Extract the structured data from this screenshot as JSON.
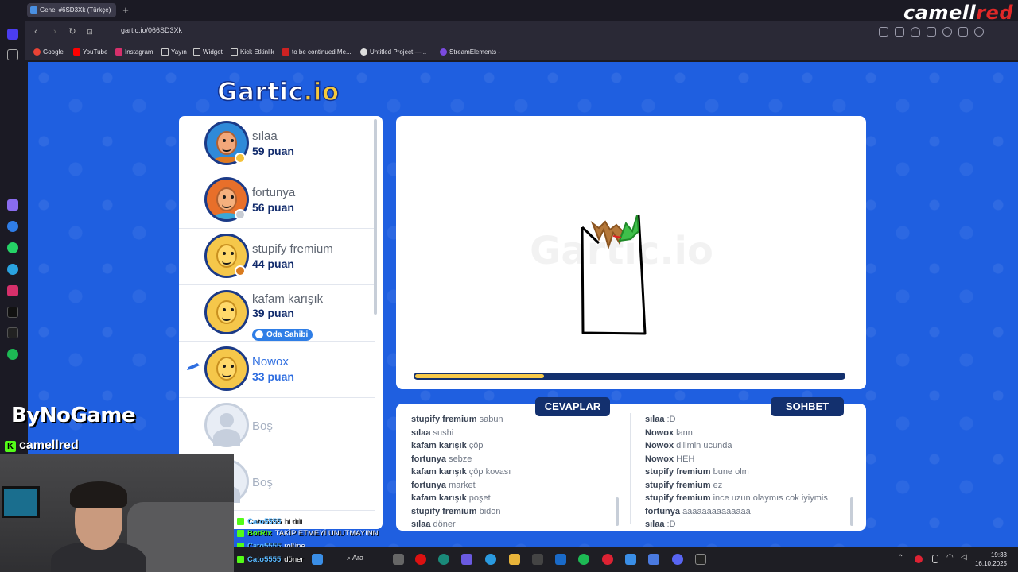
{
  "browser": {
    "tab_title": "Genel #6SD3Xk (Türkçe)",
    "url": "gartic.io/066SD3Xk",
    "overlay_brand_left": "camell",
    "overlay_brand_right": "red",
    "bookmarks": [
      "Google",
      "YouTube",
      "Instagram",
      "Yayın",
      "Widget",
      "Kick Etkinlik",
      "to be continued Me...",
      "Untitled Project —...",
      "StreamElements -"
    ]
  },
  "game": {
    "logo_main": "Gartic",
    "logo_suffix": ".io",
    "players": [
      {
        "name": "sılaa",
        "score": "59 puan",
        "rank_color": "#f5c23a"
      },
      {
        "name": "fortunya",
        "score": "56 puan",
        "rank_color": "#c7ccd4"
      },
      {
        "name": "stupify fremium",
        "score": "44 puan",
        "rank_color": "#d97b1e"
      },
      {
        "name": "kafam karışık",
        "score": "39 puan",
        "badge": "Oda Sahibi"
      },
      {
        "name": "Nowox",
        "score": "33 puan",
        "drawing": true
      }
    ],
    "empty_slots": [
      "Boş",
      "Boş"
    ],
    "timer_progress": 0.3,
    "answers_tab": "CEVAPLAR",
    "chat_tab": "SOHBET",
    "answers": [
      {
        "user": "stupify fremium",
        "text": "sabun"
      },
      {
        "user": "sılaa",
        "text": "sushi"
      },
      {
        "user": "kafam karışık",
        "text": "çöp"
      },
      {
        "user": "fortunya",
        "text": "sebze"
      },
      {
        "user": "kafam karışık",
        "text": "çöp kovası"
      },
      {
        "user": "fortunya",
        "text": "market"
      },
      {
        "user": "kafam karışık",
        "text": "poşet"
      },
      {
        "user": "stupify fremium",
        "text": "bidon"
      },
      {
        "user": "sılaa",
        "text": "döner"
      }
    ],
    "chat": [
      {
        "user": "sılaa",
        "text": ":D"
      },
      {
        "user": "Nowox",
        "text": "lann"
      },
      {
        "user": "Nowox",
        "text": "dilimin ucunda"
      },
      {
        "user": "Nowox",
        "text": "HEH"
      },
      {
        "user": "stupify fremium",
        "text": "bune olm"
      },
      {
        "user": "stupify fremium",
        "text": "ez"
      },
      {
        "user": "stupify fremium",
        "text": "ince uzun olaymıs cok iyiymis"
      },
      {
        "user": "fortunya",
        "text": "aaaaaaaaaaaaaa"
      },
      {
        "user": "sılaa",
        "text": ":D"
      }
    ]
  },
  "stream": {
    "brand": "ByNoGame",
    "username": "camellred",
    "kick_chat": [
      {
        "user": "Cato5555",
        "text": "hi dıli"
      },
      {
        "user": "BotRix",
        "text": "TAKİP ETMEYİ UNUTMAYINN"
      },
      {
        "user": "Cato5555",
        "text": "rolüne"
      },
      {
        "user": "Cato5555",
        "text": "döner"
      }
    ]
  },
  "taskbar": {
    "search_label": "Ara",
    "time": "19:33",
    "date": "16.10.2025"
  }
}
